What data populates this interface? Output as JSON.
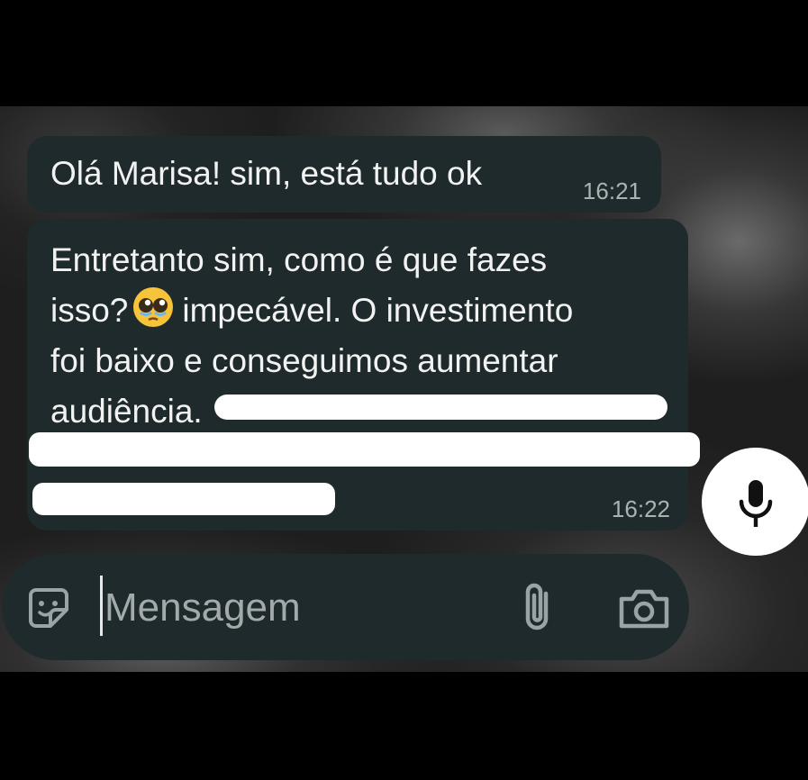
{
  "chat": {
    "messages": [
      {
        "text": "Olá Marisa! sim, está tudo ok",
        "time": "16:21"
      },
      {
        "lines": [
          "Entretanto sim, como é que fazes",
          "isso?",
          "impecável. O investimento",
          "foi baixo e conseguimos aumentar",
          "audiência."
        ],
        "emoji": "pleading-face-emoji",
        "time": "16:22"
      }
    ]
  },
  "composer": {
    "placeholder": "Mensagem",
    "icons": {
      "emoji": "sticker-icon",
      "attach": "paperclip-icon",
      "camera": "camera-icon",
      "mic": "microphone-icon"
    }
  },
  "colors": {
    "bubble": "#1f2a2c",
    "text": "#f2f2f2",
    "timestamp": "#aab2b4",
    "mic_button": "#ffffff"
  }
}
